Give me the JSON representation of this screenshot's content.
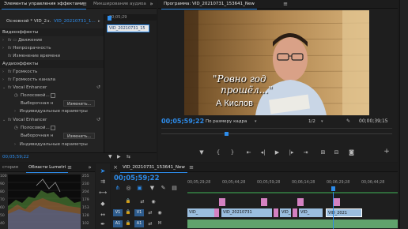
{
  "effects_panel": {
    "tabs": [
      "Элементы управления эффектами",
      "Микширование аудиоа"
    ],
    "source_clip": "Основной * VID_2...",
    "seq_clip": "VID_20210731_1...",
    "ruler_time": "00;05;29",
    "clip_label": "VID_20210731_15",
    "video_section": "Видеоэффекты",
    "audio_section": "Аудиоэффекты",
    "rows": {
      "motion": "Движение",
      "opacity": "Непрозрачность",
      "timeremap": "Изменение времени",
      "volume": "Громкость",
      "channel_volume": "Громкость канала",
      "vocal1": "Vocal Enhancer",
      "bypass1": "Полосовой...",
      "preset1": "Выборочная н",
      "edit1": "Изменить...",
      "params1": "Индивидуальные параметры",
      "vocal2": "Vocal Enhancer",
      "bypass2": "Полосовой...",
      "preset2": "Выборочная н",
      "edit2": "Изменить...",
      "params2": "Индивидуальные параметры"
    },
    "bottom_time": "00;05;59;22"
  },
  "program": {
    "title": "Программа: VID_20210731_153641_New",
    "caption_line1": "\"Ровно год",
    "caption_line2": "прошёл...\"",
    "caption_line3": "А Кислов",
    "timecode": "00;05;59;22",
    "fit": "По размеру кадра",
    "resolution": "1/2",
    "duration": "00;00;39;15"
  },
  "history_panel": {
    "tabs": [
      "стория",
      "Области Lumetri"
    ],
    "scale_left": [
      "100",
      "90",
      "80",
      "70",
      "60",
      "50",
      "40"
    ],
    "scale_right": [
      "255",
      "230",
      "204",
      "179",
      "153",
      "128",
      "102"
    ]
  },
  "timeline": {
    "tab": "VID_20210731_153641_New",
    "timecode": "00;05;59;22",
    "ruler": [
      "00;05;29;28",
      "00;05;44;28",
      "00;05;59;28",
      "00;06;14;28",
      "00;06;29;28",
      "00;06;44;28"
    ],
    "v1_label": "V1",
    "v1_target": "V1",
    "a1_label": "A1",
    "a1_target": "A1",
    "clips": [
      "VID_",
      "VID_20210731",
      "VID_",
      "VID_",
      "VID_2021"
    ]
  },
  "colors": {
    "accent": "#2d8ceb",
    "panel_bg": "#232323",
    "video_clip": "#9bbedf",
    "pink_clip": "#d481c2",
    "audio_clip": "#5fa36c"
  }
}
